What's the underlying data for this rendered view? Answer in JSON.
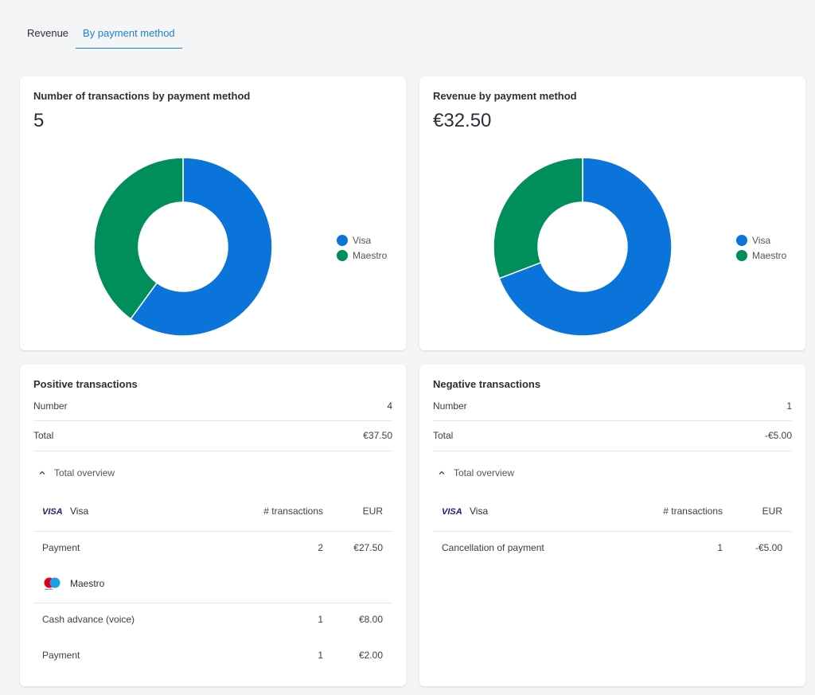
{
  "tabs": [
    {
      "label": "Revenue",
      "active": false
    },
    {
      "label": "By payment method",
      "active": true
    }
  ],
  "colors": {
    "visa": "#0a74da",
    "maestro": "#008e5a",
    "accent": "#1a82d9"
  },
  "transactions_card": {
    "title": "Number of transactions by payment method",
    "value": "5",
    "legend": [
      "Visa",
      "Maestro"
    ]
  },
  "revenue_card": {
    "title": "Revenue by payment method",
    "value": "€32.50",
    "legend": [
      "Visa",
      "Maestro"
    ]
  },
  "chart_data": [
    {
      "type": "pie",
      "title": "Number of transactions by payment method",
      "labels": [
        "Visa",
        "Maestro"
      ],
      "values": [
        3,
        2
      ],
      "donut": true,
      "legend": "right"
    },
    {
      "type": "pie",
      "title": "Revenue by payment method",
      "labels": [
        "Visa",
        "Maestro"
      ],
      "values": [
        22.5,
        10.0
      ],
      "donut": true,
      "legend": "right"
    }
  ],
  "positive": {
    "title": "Positive transactions",
    "number_label": "Number",
    "number_value": "4",
    "total_label": "Total",
    "total_value": "€37.50",
    "overview_label": "Total overview",
    "col_count": "# transactions",
    "col_amount": "EUR",
    "groups": [
      {
        "brand": "Visa",
        "icon": "visa-logo-icon",
        "rows": [
          {
            "name": "Payment",
            "count": "2",
            "amount": "€27.50"
          }
        ]
      },
      {
        "brand": "Maestro",
        "icon": "maestro-logo-icon",
        "rows": [
          {
            "name": "Cash advance (voice)",
            "count": "1",
            "amount": "€8.00"
          },
          {
            "name": "Payment",
            "count": "1",
            "amount": "€2.00"
          }
        ]
      }
    ]
  },
  "negative": {
    "title": "Negative transactions",
    "number_label": "Number",
    "number_value": "1",
    "total_label": "Total",
    "total_value": "-€5.00",
    "overview_label": "Total overview",
    "col_count": "# transactions",
    "col_amount": "EUR",
    "groups": [
      {
        "brand": "Visa",
        "icon": "visa-logo-icon",
        "rows": [
          {
            "name": "Cancellation of payment",
            "count": "1",
            "amount": "-€5.00"
          }
        ]
      }
    ]
  }
}
